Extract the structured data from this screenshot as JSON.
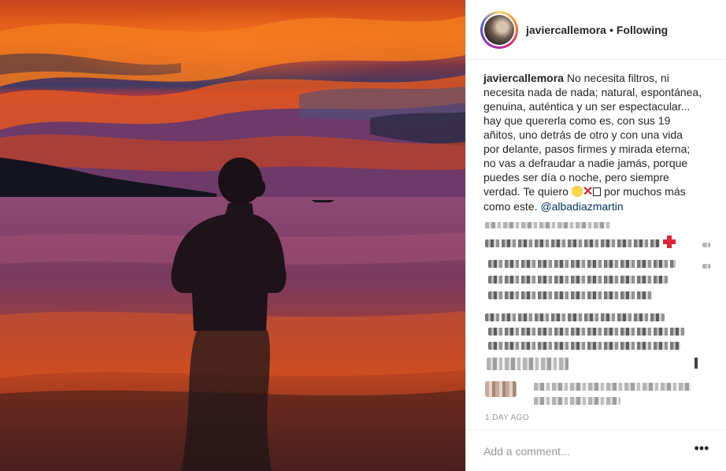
{
  "post": {
    "username": "javiercallemora",
    "separator": "•",
    "follow_status": "Following",
    "caption": {
      "author": "javiercallemora",
      "line1": "No necesita filtros, ni",
      "line2": "necesita nada de nada; natural, espontánea,",
      "line3": "genuina, auténtica y un ser espectacular...",
      "line4": "hay que quererla como es, con sus 19",
      "line5": "añitos, uno detrás de otro y con una vida",
      "line6": "por delante, pasos firmes y mirada eterna;",
      "line7": "no vas a defraudar a nadie jamás, porque",
      "line8": "puedes ser día o noche, pero siempre",
      "line9_before": "verdad. Te quiero",
      "emoji_x": "✕",
      "line9_after": "por muchos más",
      "line10": "como este.",
      "mention": "@albadiazmartin"
    },
    "timestamp": "1 DAY AGO",
    "comment_placeholder": "Add a comment...",
    "more_label": "•••"
  },
  "icons": {
    "chick": "hatching-chick-icon",
    "cross": "cross-mark-icon",
    "box": "unknown-glyph-icon"
  },
  "colors": {
    "text": "#262626",
    "muted": "#999999",
    "mention": "#003569",
    "border": "#efefef"
  }
}
